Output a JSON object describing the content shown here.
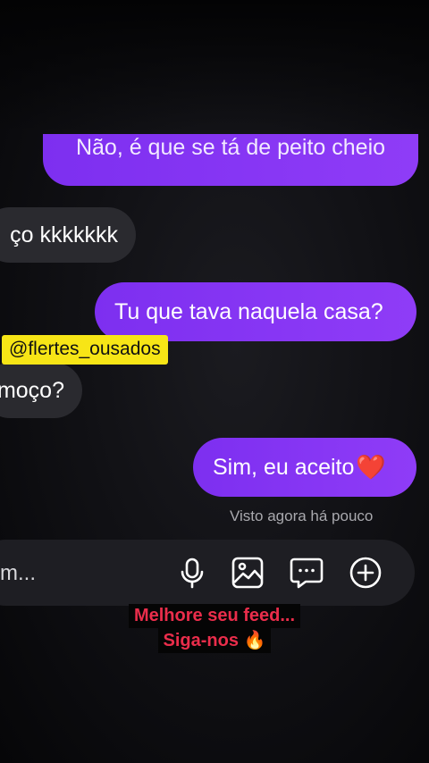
{
  "messages": [
    {
      "text": "Não, é que se tá de peito cheio",
      "side": "sent"
    },
    {
      "text": "ço kkkkkkk",
      "side": "received"
    },
    {
      "text": "Tu que tava naquela casa?",
      "side": "sent"
    },
    {
      "text": "moço?",
      "side": "received"
    },
    {
      "text": "Sim, eu aceito",
      "emoji": "❤️",
      "side": "sent"
    }
  ],
  "watermark": "@flertes_ousados",
  "seen_status": "Visto agora há pouco",
  "composer": {
    "placeholder_fragment": "m...",
    "icons": [
      "microphone-icon",
      "gallery-icon",
      "chat-bubble-icon",
      "plus-icon"
    ]
  },
  "promo": {
    "line1": "Melhore seu feed...",
    "line2": "Siga-nos",
    "emoji": "🔥"
  },
  "colors": {
    "sent_bubble": "#8a36f5",
    "received_bubble": "#2a2a2f",
    "watermark_bg": "#f7e516",
    "promo_text": "#ea2d4b"
  }
}
